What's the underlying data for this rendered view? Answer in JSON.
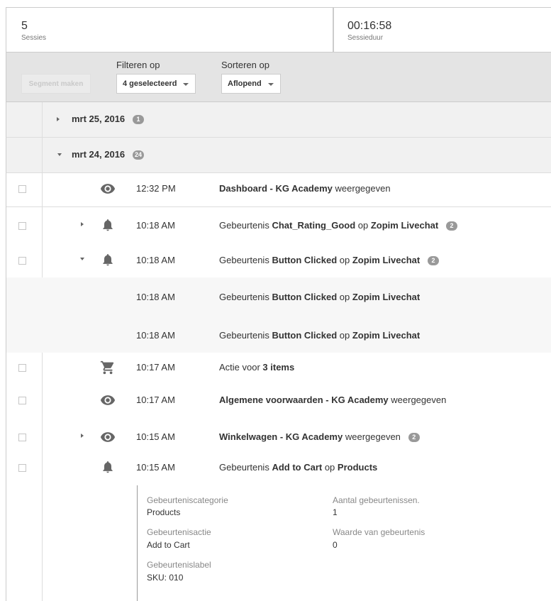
{
  "stats": [
    {
      "value": "5",
      "label": "Sessies"
    },
    {
      "value": "00:16:58",
      "label": "Sessieduur"
    }
  ],
  "controls": {
    "segment_button": "Segment maken",
    "filter_label": "Filteren op",
    "filter_value": "4 geselecteerd",
    "sort_label": "Sorteren op",
    "sort_value": "Aflopend"
  },
  "dates": [
    {
      "date": "mrt 25, 2016",
      "count": "1",
      "expanded": false
    },
    {
      "date": "mrt 24, 2016",
      "count": "24",
      "expanded": true
    }
  ],
  "events": [
    {
      "time": "12:32 PM",
      "icon": "eye-icon",
      "parts": [
        [
          "b",
          "Dashboard - KG Academy"
        ],
        [
          "t",
          " weergegeven"
        ]
      ],
      "count": ""
    },
    {
      "time": "10:18 AM",
      "icon": "bell-icon",
      "parts": [
        [
          "t",
          "Gebeurtenis "
        ],
        [
          "b",
          "Chat_Rating_Good"
        ],
        [
          "t",
          " op "
        ],
        [
          "b",
          "Zopim Livechat"
        ]
      ],
      "count": "2"
    },
    {
      "time": "10:18 AM",
      "icon": "bell-icon",
      "parts": [
        [
          "t",
          "Gebeurtenis "
        ],
        [
          "b",
          "Button Clicked"
        ],
        [
          "t",
          " op "
        ],
        [
          "b",
          "Zopim Livechat"
        ]
      ],
      "count": "2"
    },
    {
      "time": "10:18 AM",
      "icon": "",
      "parts": [
        [
          "t",
          "Gebeurtenis "
        ],
        [
          "b",
          "Button Clicked"
        ],
        [
          "t",
          " op "
        ],
        [
          "b",
          "Zopim Livechat"
        ]
      ],
      "count": ""
    },
    {
      "time": "10:18 AM",
      "icon": "",
      "parts": [
        [
          "t",
          "Gebeurtenis "
        ],
        [
          "b",
          "Button Clicked"
        ],
        [
          "t",
          " op "
        ],
        [
          "b",
          "Zopim Livechat"
        ]
      ],
      "count": ""
    },
    {
      "time": "10:17 AM",
      "icon": "cart-icon",
      "parts": [
        [
          "t",
          "Actie voor "
        ],
        [
          "b",
          "3 items"
        ]
      ],
      "count": ""
    },
    {
      "time": "10:17 AM",
      "icon": "eye-icon",
      "parts": [
        [
          "b",
          "Algemene voorwaarden - KG Academy"
        ],
        [
          "t",
          " weergegeven"
        ]
      ],
      "count": ""
    },
    {
      "time": "10:15 AM",
      "icon": "eye-icon",
      "parts": [
        [
          "b",
          "Winkelwagen - KG Academy"
        ],
        [
          "t",
          " weergegeven"
        ]
      ],
      "count": "2"
    },
    {
      "time": "10:15 AM",
      "icon": "bell-icon",
      "parts": [
        [
          "t",
          "Gebeurtenis "
        ],
        [
          "b",
          "Add to Cart"
        ],
        [
          "t",
          " op "
        ],
        [
          "b",
          "Products"
        ]
      ],
      "count": ""
    }
  ],
  "details": [
    {
      "label": "Gebeurteniscategorie",
      "value": "Products"
    },
    {
      "label": "Aantal gebeurtenissen.",
      "value": "1"
    },
    {
      "label": "Gebeurtenisactie",
      "value": "Add to Cart"
    },
    {
      "label": "Waarde van gebeurtenis",
      "value": "0"
    },
    {
      "label": "Gebeurtenislabel",
      "value": "SKU: 010"
    }
  ]
}
